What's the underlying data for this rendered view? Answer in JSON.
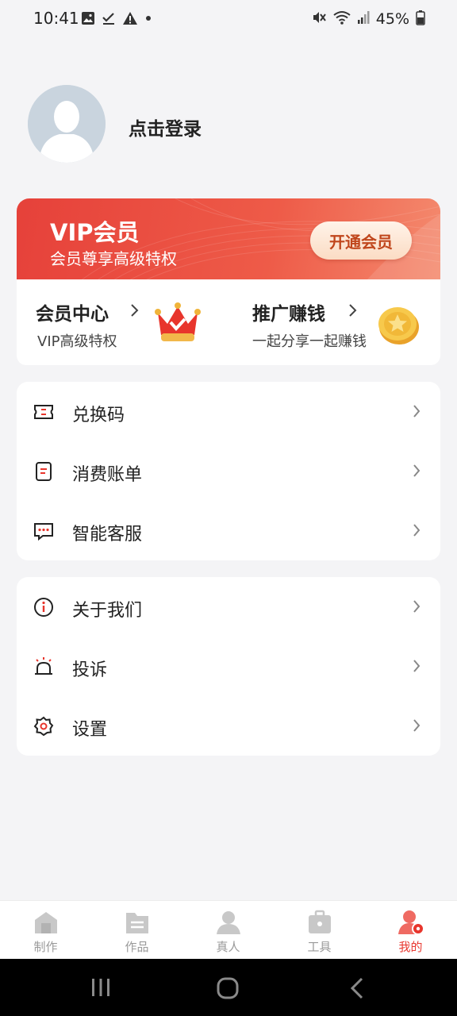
{
  "status_bar": {
    "time": "10:41",
    "battery": "45%"
  },
  "profile": {
    "login_text": "点击登录"
  },
  "vip": {
    "title": "VIP会员",
    "subtitle": "会员尊享高级特权",
    "open_button": "开通会员"
  },
  "member_card": {
    "center_title": "会员中心",
    "center_sub": "VIP高级特权",
    "promo_title": "推广赚钱",
    "promo_sub": "一起分享一起赚钱"
  },
  "menu_group_1": [
    {
      "label": "兑换码",
      "icon": "ticket-icon"
    },
    {
      "label": "消费账单",
      "icon": "bill-icon"
    },
    {
      "label": "智能客服",
      "icon": "chat-icon"
    }
  ],
  "menu_group_2": [
    {
      "label": "关于我们",
      "icon": "info-icon"
    },
    {
      "label": "投诉",
      "icon": "alarm-icon"
    },
    {
      "label": "设置",
      "icon": "gear-icon"
    }
  ],
  "tabs": [
    {
      "label": "制作",
      "active": false
    },
    {
      "label": "作品",
      "active": false
    },
    {
      "label": "真人",
      "active": false
    },
    {
      "label": "工具",
      "active": false
    },
    {
      "label": "我的",
      "active": true
    }
  ],
  "colors": {
    "accent": "#e83a32",
    "banner": "#e6413a",
    "background": "#f4f4f6"
  }
}
